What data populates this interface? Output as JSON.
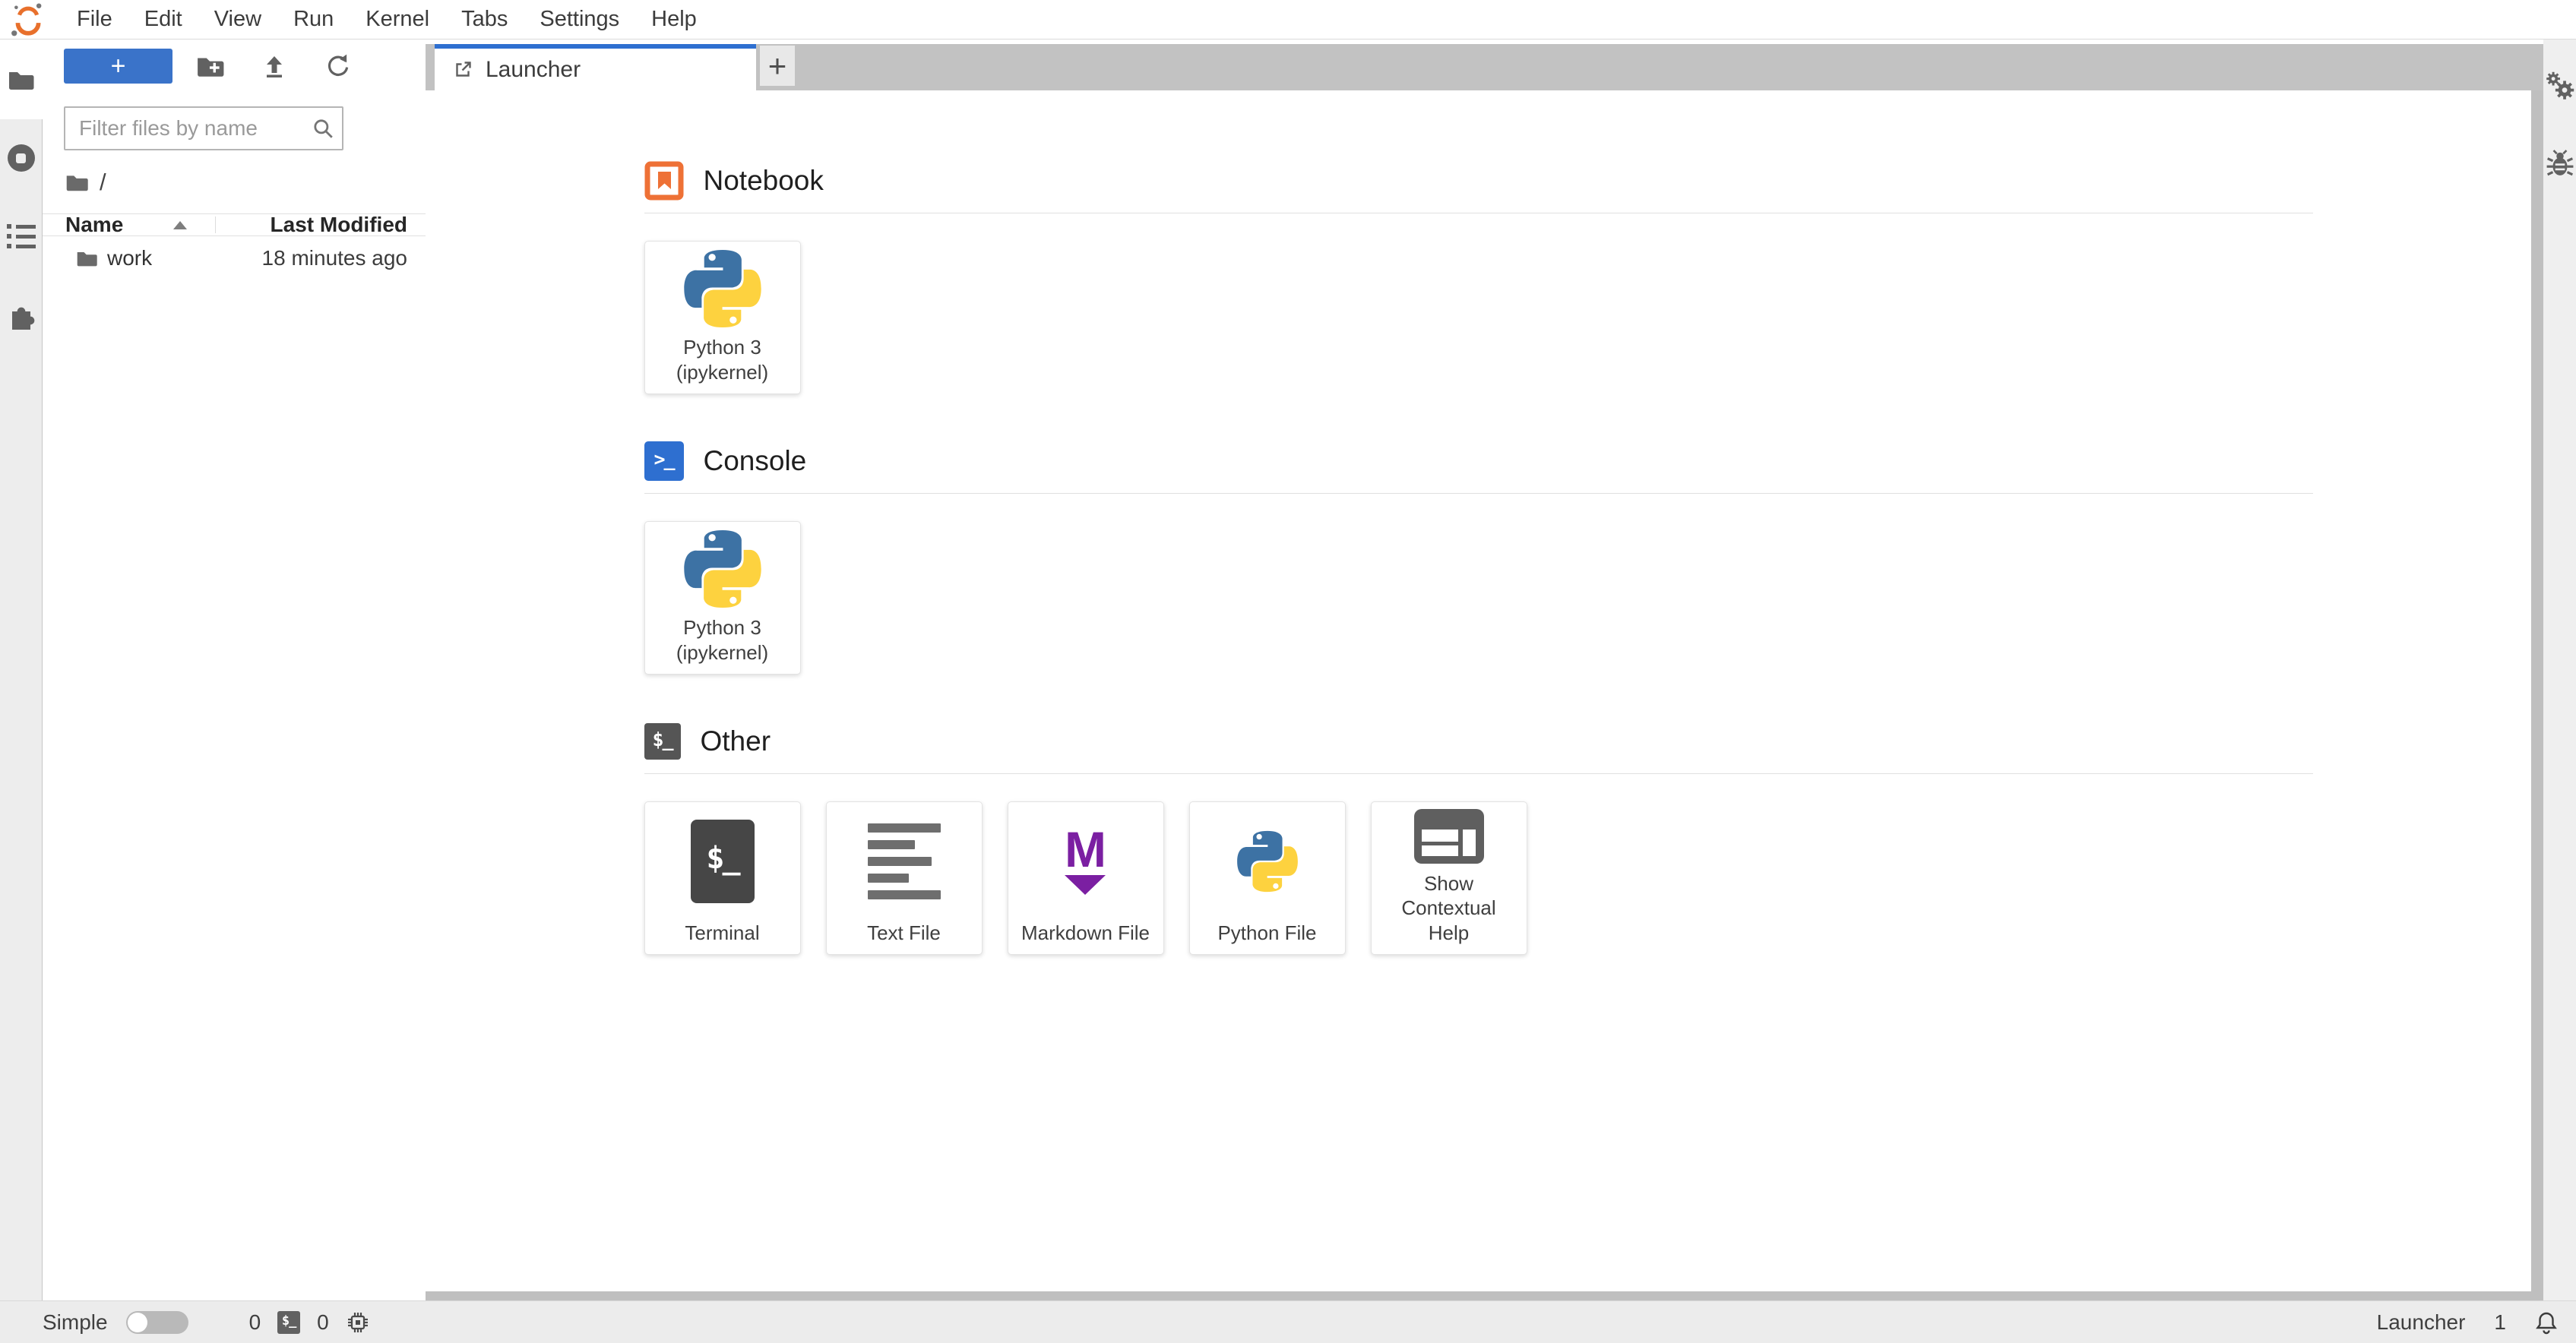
{
  "menu_bar": {
    "items": [
      "File",
      "Edit",
      "View",
      "Run",
      "Kernel",
      "Tabs",
      "Settings",
      "Help"
    ]
  },
  "left_sidebar": {
    "tabs": [
      {
        "icon": "folder-icon",
        "name": "file-browser",
        "active": true
      },
      {
        "icon": "running-icon",
        "name": "running-terminals-and-kernels",
        "active": false
      },
      {
        "icon": "list-icon",
        "name": "table-of-contents",
        "active": false
      },
      {
        "icon": "puzzle-icon",
        "name": "extension-manager",
        "active": false
      }
    ]
  },
  "file_browser": {
    "new_launcher_label": "+",
    "toolbar_icons": [
      "new-folder-icon",
      "upload-icon",
      "refresh-icon"
    ],
    "filter_placeholder": "Filter files by name",
    "breadcrumb_root": "/",
    "columns": [
      "Name",
      "Last Modified"
    ],
    "sort": {
      "column": "Name",
      "direction": "asc"
    },
    "rows": [
      {
        "icon": "folder-icon",
        "name": "work",
        "modified": "18 minutes ago"
      }
    ]
  },
  "dock": {
    "tabs": [
      {
        "label": "Launcher",
        "icon": "launcher-icon",
        "active": true
      }
    ],
    "add_tab_label": "+"
  },
  "launcher": {
    "sections": [
      {
        "title": "Notebook",
        "icon": "notebook-icon",
        "cards": [
          {
            "label": "Python 3 (ipykernel)",
            "icon": "python-logo"
          }
        ]
      },
      {
        "title": "Console",
        "icon": "console-icon",
        "icon_glyph": ">_",
        "cards": [
          {
            "label": "Python 3 (ipykernel)",
            "icon": "python-logo"
          }
        ]
      },
      {
        "title": "Other",
        "icon": "terminal-icon",
        "icon_glyph": "$_",
        "cards": [
          {
            "label": "Terminal",
            "icon": "terminal-icon",
            "glyph": "$_"
          },
          {
            "label": "Text File",
            "icon": "text-lines-icon"
          },
          {
            "label": "Markdown File",
            "icon": "markdown-icon",
            "glyph": "M"
          },
          {
            "label": "Python File",
            "icon": "python-logo"
          },
          {
            "label": "Show Contextual Help",
            "icon": "layout-split-icon"
          }
        ]
      }
    ]
  },
  "status_bar": {
    "mode_label": "Simple",
    "mode_toggle_on": false,
    "terminals_count": "0",
    "terminal_badge_glyph": "$_",
    "kernels_count": "0",
    "current_widget": "Launcher",
    "notifications_count": "1"
  },
  "colors": {
    "accent_blue": "#2e6fd0",
    "button_blue": "#3a73c9",
    "jupyter_orange": "#e8702c",
    "markdown_purple": "#7b1fa2",
    "python_blue": "#3d72a4",
    "python_yellow": "#fdd23f",
    "icon_gray": "#616161",
    "tabbar_gray": "#c2c2c2"
  }
}
